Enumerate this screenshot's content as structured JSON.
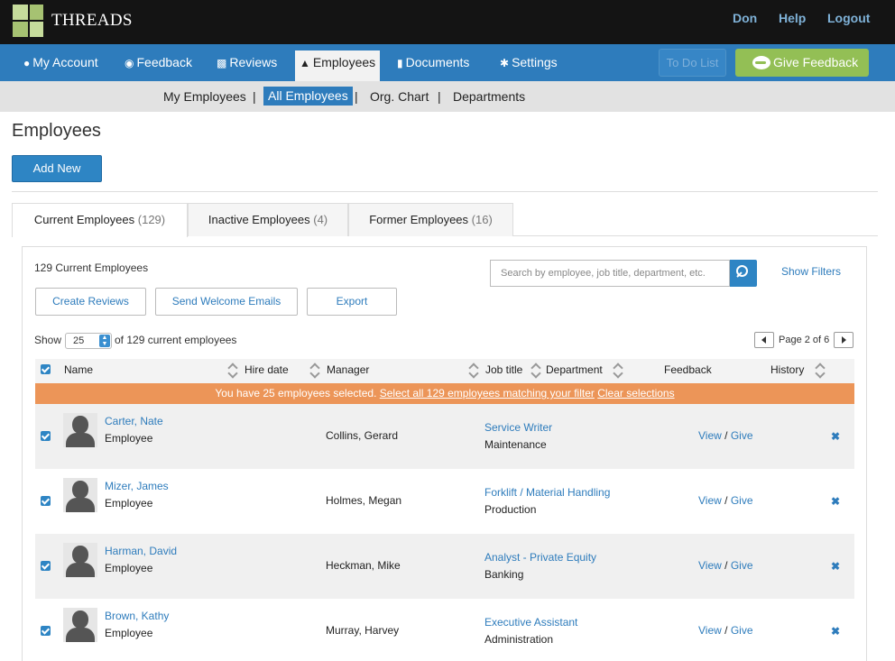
{
  "app": {
    "name": "THREADS"
  },
  "topnav": {
    "user": "Don",
    "help": "Help",
    "logout": "Logout"
  },
  "mainnav": {
    "items": [
      {
        "label": "My Account",
        "icon": "user-icon"
      },
      {
        "label": "Feedback",
        "icon": "comment-icon"
      },
      {
        "label": "Reviews",
        "icon": "document-icon"
      },
      {
        "label": "Employees",
        "icon": "org-chart-icon"
      },
      {
        "label": "Documents",
        "icon": "folder-icon"
      },
      {
        "label": "Settings",
        "icon": "gear-icon"
      }
    ],
    "active": "Employees",
    "todo_label": "To Do List",
    "give_feedback_label": "Give Feedback"
  },
  "subnav": {
    "items": [
      "My Employees",
      "All Employees",
      "Org. Chart",
      "Departments"
    ],
    "separator": "|",
    "active": "All Employees"
  },
  "page": {
    "title": "Employees",
    "add_new_label": "Add New"
  },
  "tabs": [
    {
      "label": "Current Employees",
      "count": "(129)"
    },
    {
      "label": "Inactive Employees",
      "count": "(4)"
    },
    {
      "label": "Former Employees",
      "count": "(16)"
    }
  ],
  "toolbar": {
    "count_text": "129 Current Employees",
    "search_placeholder": "Search by employee, job title, department, etc.",
    "show_filters": "Show Filters",
    "create_reviews": "Create Reviews",
    "send_welcome": "Send Welcome Emails",
    "export": "Export"
  },
  "paging": {
    "show_label": "Show",
    "page_size": "25",
    "of_text": "of 129 current employees",
    "page_text": "Page 2 of 6"
  },
  "table": {
    "headers": {
      "name": "Name",
      "hire_date": "Hire date",
      "manager": "Manager",
      "job_title": "Job title",
      "department": "Department",
      "feedback": "Feedback",
      "history": "History"
    },
    "selection": {
      "text": "You have 25 employees selected.",
      "select_all": "Select all 129 employees matching your filter",
      "clear": "Clear selections"
    },
    "feedback_view": "View",
    "feedback_sep": "/",
    "feedback_give": "Give",
    "rows": [
      {
        "name": "Carter, Nate",
        "role": "Employee",
        "manager": "Collins, Gerard",
        "job_title": "Service Writer",
        "department": "Maintenance"
      },
      {
        "name": "Mizer, James",
        "role": "Employee",
        "manager": "Holmes, Megan",
        "job_title": "Forklift / Material Handling",
        "department": "Production"
      },
      {
        "name": "Harman, David",
        "role": "Employee",
        "manager": "Heckman, Mike",
        "job_title": "Analyst - Private Equity",
        "department": "Banking"
      },
      {
        "name": "Brown, Kathy",
        "role": "Employee",
        "manager": "Murray, Harvey",
        "job_title": "Executive Assistant",
        "department": "Administration"
      }
    ]
  },
  "colors": {
    "nav_blue": "#2e7cbc",
    "give_green": "#93bf55",
    "selection_orange": "#ec9558",
    "link_blue": "#2e7cbc"
  }
}
